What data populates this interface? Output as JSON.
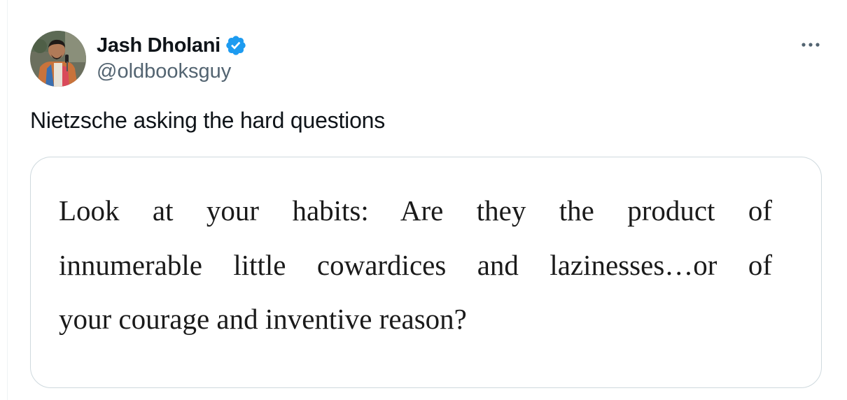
{
  "author": {
    "display_name": "Jash Dholani",
    "handle": "@oldbooksguy",
    "verified": true,
    "avatar_icon": "profile-photo-avatar"
  },
  "menu": {
    "icon": "more-options-icon"
  },
  "tweet": {
    "text": "Nietzsche asking the hard questions"
  },
  "media": {
    "quote_lines": [
      "Look at your habits: Are they the product of",
      "innumerable little cowardices and lazinesses…or of",
      "your courage and inventive reason?"
    ]
  },
  "colors": {
    "text_primary": "#0f1419",
    "text_secondary": "#536471",
    "verified_blue": "#1d9bf0",
    "card_border": "#cfd9de"
  }
}
